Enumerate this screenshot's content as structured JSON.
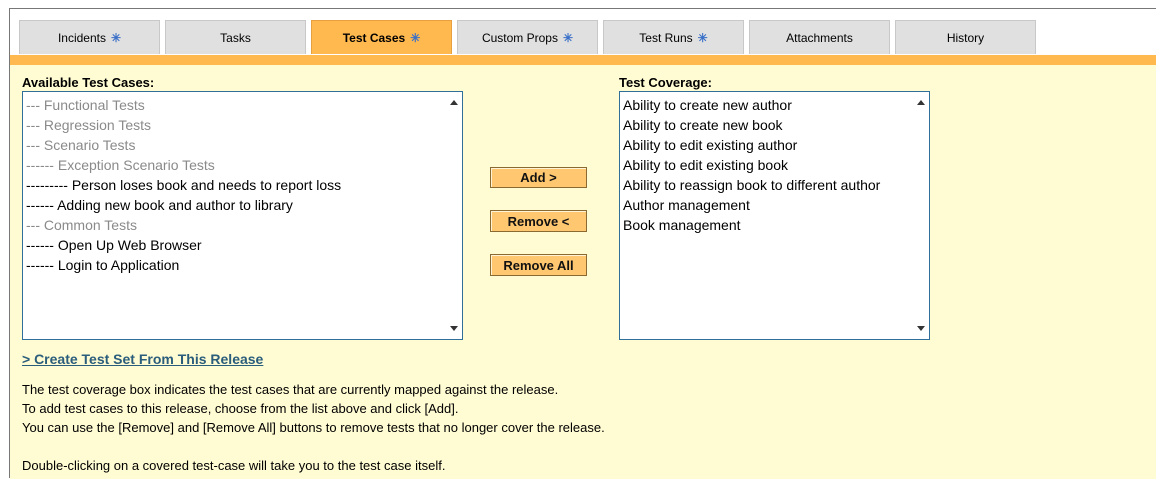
{
  "tabs": [
    {
      "label": "Incidents",
      "star": "✳"
    },
    {
      "label": "Tasks",
      "star": ""
    },
    {
      "label": "Test Cases",
      "star": "✳"
    },
    {
      "label": "Custom Props",
      "star": "✳"
    },
    {
      "label": "Test Runs",
      "star": "✳"
    },
    {
      "label": "Attachments",
      "star": ""
    },
    {
      "label": "History",
      "star": ""
    }
  ],
  "active_tab": "Test Cases",
  "available": {
    "label": "Available Test Cases:",
    "items": [
      {
        "text": "--- Functional Tests",
        "folder": true
      },
      {
        "text": "--- Regression Tests",
        "folder": true
      },
      {
        "text": "--- Scenario Tests",
        "folder": true
      },
      {
        "text": "------ Exception Scenario Tests",
        "folder": true
      },
      {
        "text": "--------- Person loses book and needs to report loss",
        "folder": false
      },
      {
        "text": "------ Adding new book and author to library",
        "folder": false
      },
      {
        "text": "--- Common Tests",
        "folder": true
      },
      {
        "text": "------ Open Up Web Browser",
        "folder": false
      },
      {
        "text": "------ Login to Application",
        "folder": false
      }
    ]
  },
  "coverage": {
    "label": "Test Coverage:",
    "items": [
      "Ability to create new author",
      "Ability to create new book",
      "Ability to edit existing author",
      "Ability to edit existing book",
      "Ability to reassign book to different author",
      "Author management",
      "Book management"
    ]
  },
  "buttons": {
    "add": "Add >",
    "remove": "Remove <",
    "remove_all": "Remove All"
  },
  "create_link": "> Create Test Set From This Release",
  "help": {
    "line1": "The test coverage box indicates the test cases that are currently mapped against the release.",
    "line2": "To add test cases to this release, choose from the list above and click [Add].",
    "line3": "You can use the [Remove] and [Remove All] buttons to remove tests that no longer cover the release.",
    "line4": "Double-clicking on a covered test-case will take you to the test case itself."
  },
  "colors": {
    "accent": "#ffb94f",
    "panel": "#fffbd2",
    "link": "#2a5d7c",
    "star": "#3a70c8"
  }
}
